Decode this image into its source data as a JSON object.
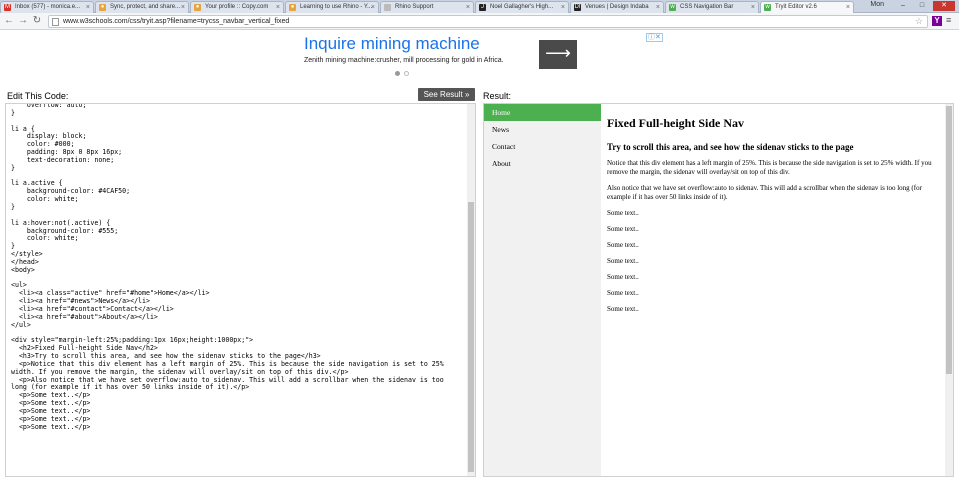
{
  "browser": {
    "tabs": [
      {
        "label": "Inbox (577) - monica.e...",
        "color": "#d93025",
        "glyph": "M"
      },
      {
        "label": "Sync, protect, and share...",
        "color": "#e8a33c",
        "glyph": "●"
      },
      {
        "label": "Your profile :: Copy.com",
        "color": "#e8a33c",
        "glyph": "●"
      },
      {
        "label": "Learning to use Rhino - Y...",
        "color": "#e8a33c",
        "glyph": "●"
      },
      {
        "label": "Rhino Support",
        "color": "#bbb",
        "glyph": ""
      },
      {
        "label": "Noel Gallagher's High...",
        "color": "#222",
        "glyph": "J"
      },
      {
        "label": "Venues | Design Indaba",
        "color": "#222",
        "glyph": "DI"
      },
      {
        "label": "CSS Navigation Bar",
        "color": "#4CAF50",
        "glyph": "w"
      },
      {
        "label": "Tryit Editor v2.6",
        "color": "#4CAF50",
        "glyph": "w",
        "active": true
      }
    ],
    "user": "Mon",
    "url": "www.w3schools.com/css/tryit.asp?filename=trycss_navbar_vertical_fixed"
  },
  "ad": {
    "title": "Inquire mining machine",
    "description": "Zenith mining machine:crusher, mill processing for gold in Africa.",
    "arrow": "⟶"
  },
  "editor": {
    "label": "Edit This Code:",
    "see_result": "See Result »",
    "result_label": "Result:",
    "code": "    overflow: auto;\n}\n\nli a {\n    display: block;\n    color: #000;\n    padding: 8px 0 8px 16px;\n    text-decoration: none;\n}\n\nli a.active {\n    background-color: #4CAF50;\n    color: white;\n}\n\nli a:hover:not(.active) {\n    background-color: #555;\n    color: white;\n}\n</style>\n</head>\n<body>\n\n<ul>\n  <li><a class=\"active\" href=\"#home\">Home</a></li>\n  <li><a href=\"#news\">News</a></li>\n  <li><a href=\"#contact\">Contact</a></li>\n  <li><a href=\"#about\">About</a></li>\n</ul>\n\n<div style=\"margin-left:25%;padding:1px 16px;height:1000px;\">\n  <h2>Fixed Full-height Side Nav</h2>\n  <h3>Try to scroll this area, and see how the sidenav sticks to the page</h3>\n  <p>Notice that this div element has a left margin of 25%. This is because the side navigation is set to 25%\nwidth. If you remove the margin, the sidenav will overlay/sit on top of this div.</p>\n  <p>Also notice that we have set overflow:auto to sidenav. This will add a scrollbar when the sidenav is too\nlong (for example if it has over 50 links inside of it).</p>\n  <p>Some text..</p>\n  <p>Some text..</p>\n  <p>Some text..</p>\n  <p>Some text..</p>\n  <p>Some text..</p>"
  },
  "result": {
    "nav": [
      "Home",
      "News",
      "Contact",
      "About"
    ],
    "heading": "Fixed Full-height Side Nav",
    "subheading": "Try to scroll this area, and see how the sidenav sticks to the page",
    "para1": "Notice that this div element has a left margin of 25%. This is because the side navigation is set to 25% width. If you remove the margin, the sidenav will overlay/sit on top of this div.",
    "para2": "Also notice that we have set overflow:auto to sidenav. This will add a scrollbar when the sidenav is too long (for example if it has over 50 links inside of it).",
    "some_text": [
      "Some text..",
      "Some text..",
      "Some text..",
      "Some text..",
      "Some text..",
      "Some text..",
      "Some text.."
    ]
  },
  "colors": {
    "active_nav": "#4CAF50",
    "see_result_bg": "#555555",
    "ad_title": "#1a73e8"
  }
}
